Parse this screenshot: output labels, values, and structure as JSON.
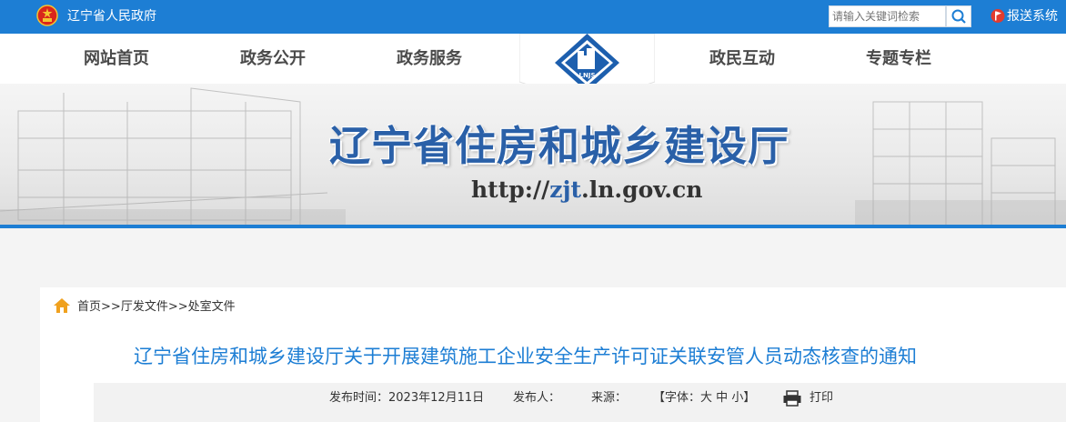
{
  "header": {
    "gov_name": "辽宁省人民政府",
    "search_placeholder": "请输入关键词检索",
    "report_label": "报送系统"
  },
  "nav": {
    "items": [
      "网站首页",
      "政务公开",
      "政务服务",
      "政民互动",
      "专题专栏"
    ],
    "logo_text": "LNJS"
  },
  "banner": {
    "title": "辽宁省住房和城乡建设厅",
    "url_prefix": "http://",
    "url_highlight": "zjt",
    "url_suffix": ".ln.gov.cn"
  },
  "breadcrumb": {
    "home": "首页",
    "sep": ">>",
    "level1": "厅发文件",
    "level2": "处室文件"
  },
  "article": {
    "title": "辽宁省住房和城乡建设厅关于开展建筑施工企业安全生产许可证关联安管人员动态核查的通知",
    "publish_time": "发布时间：2023年12月11日",
    "publisher": "发布人：",
    "source": "来源：",
    "font_open": "【字体：",
    "font_large": "大",
    "font_medium": "中",
    "font_small": "小",
    "font_close": "】",
    "print_label": "打印"
  },
  "colors": {
    "brand_blue": "#1d7ed4",
    "title_blue": "#2a60a8"
  }
}
